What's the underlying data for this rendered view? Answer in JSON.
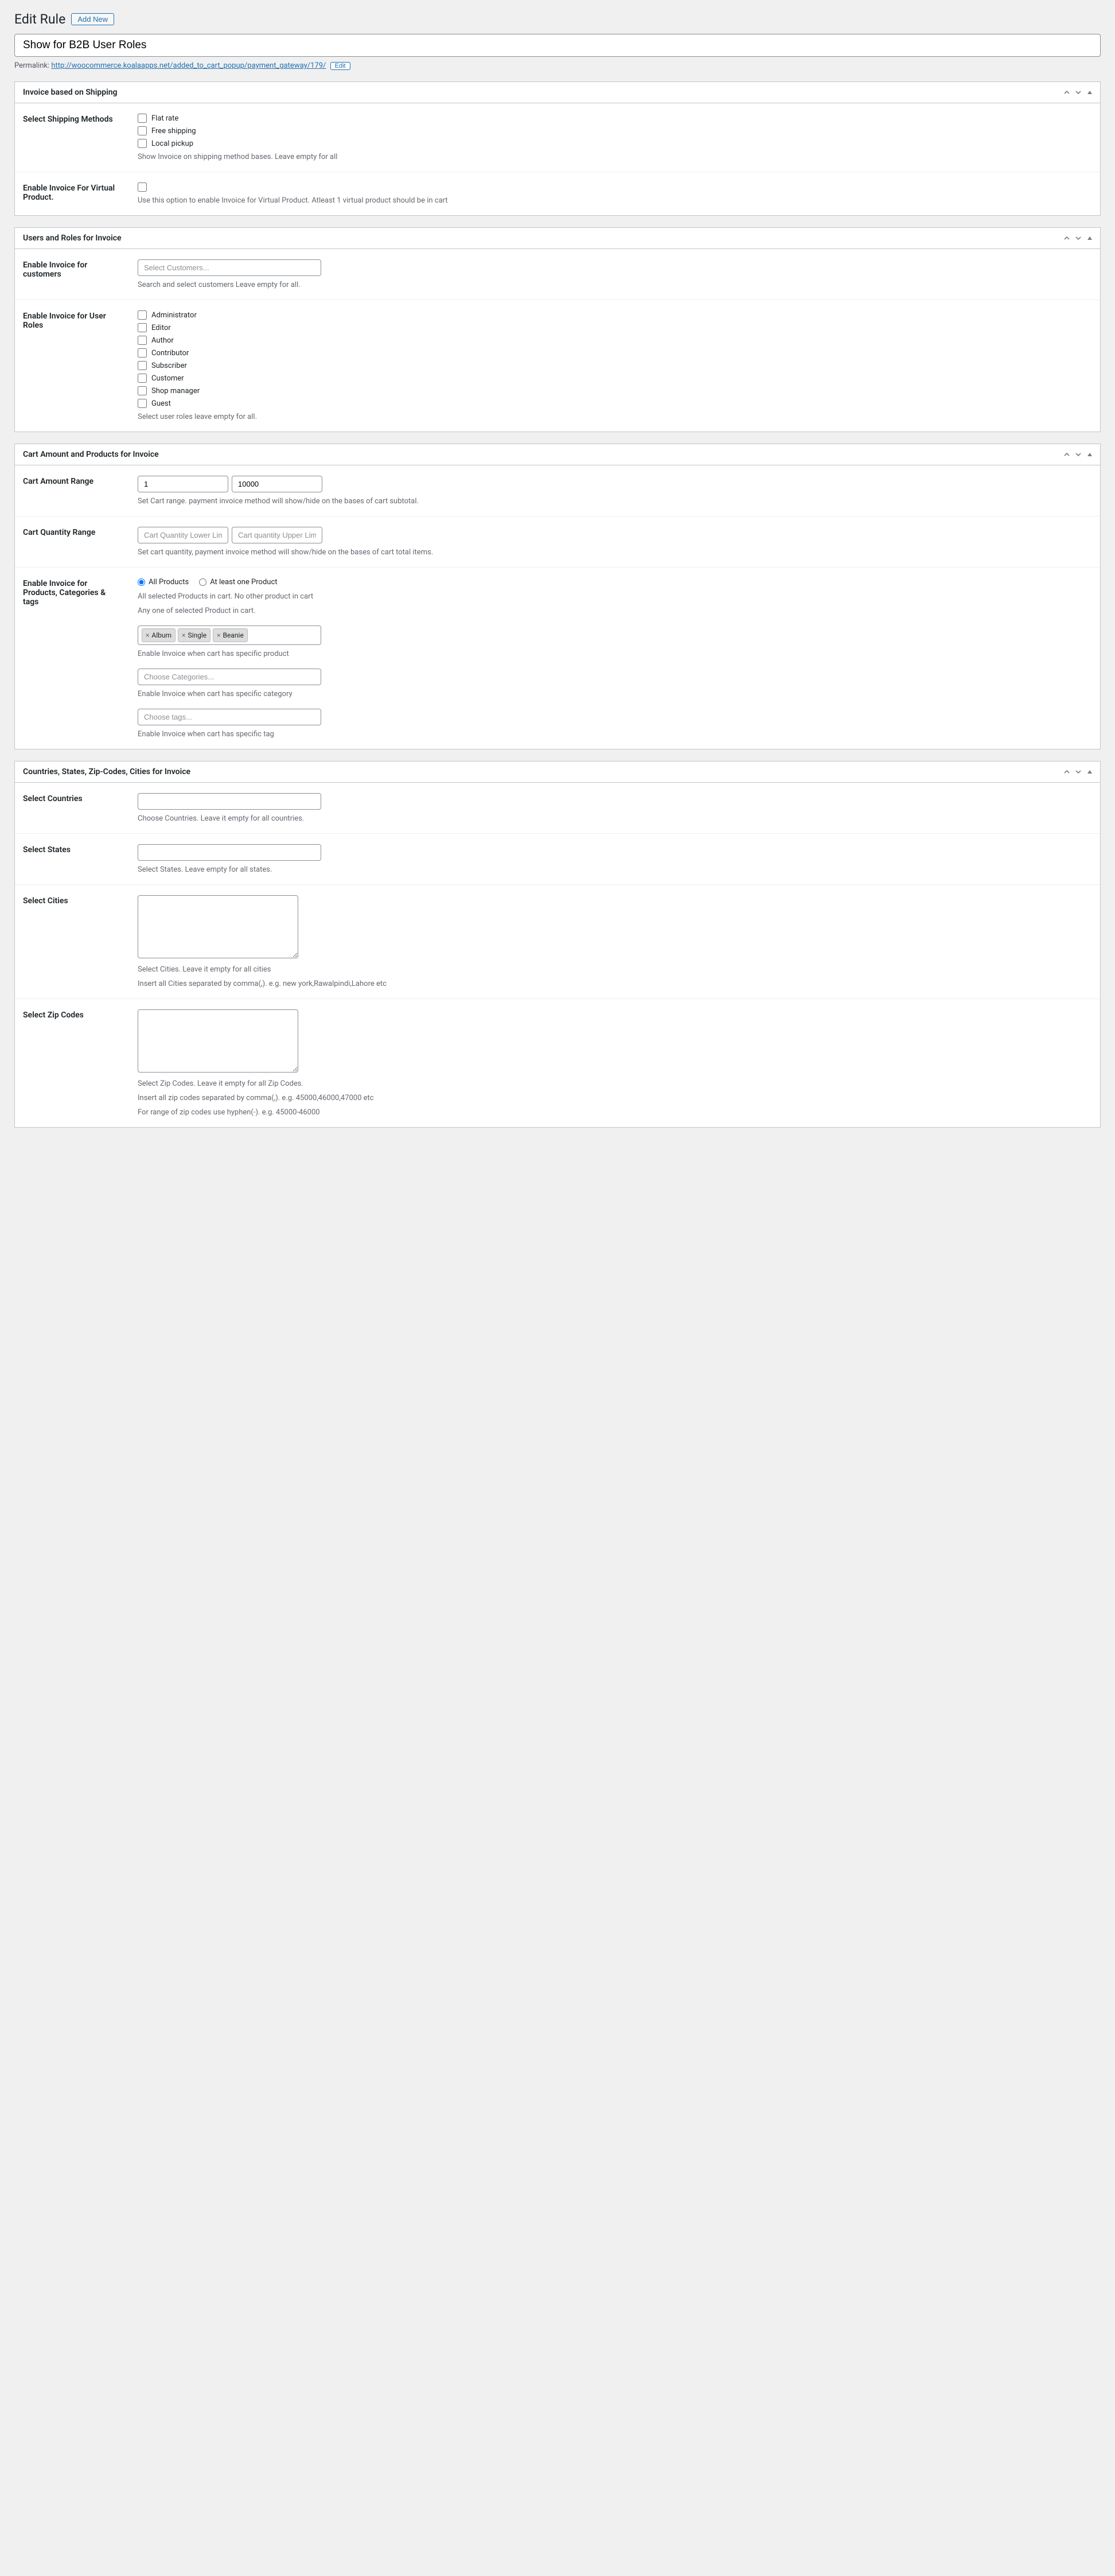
{
  "header": {
    "page_title": "Edit Rule",
    "add_new": "Add New"
  },
  "title_value": "Show for B2B User Roles",
  "permalink": {
    "label": "Permalink: ",
    "url": "http://woocommerce.koalaapps.net/added_to_cart_popup/payment_gateway/",
    "id": "179",
    "slash": "/",
    "edit": "Edit"
  },
  "box1": {
    "title": "Invoice based on Shipping",
    "shipping": {
      "label": "Select Shipping Methods",
      "opt1": "Flat rate",
      "opt2": "Free shipping",
      "opt3": "Local pickup",
      "desc": "Show Invoice on shipping method bases. Leave empty for all"
    },
    "virtual": {
      "label": "Enable Invoice For Virtual Product.",
      "desc": "Use this option to enable Invoice for Virtual Product. Atleast 1 virtual product should be in cart"
    }
  },
  "box2": {
    "title": "Users and Roles for Invoice",
    "customers": {
      "label": "Enable Invoice for customers",
      "placeholder": "Select Customers...",
      "desc": "Search and select customers Leave empty for all."
    },
    "roles": {
      "label": "Enable Invoice for User Roles",
      "r1": "Administrator",
      "r2": "Editor",
      "r3": "Author",
      "r4": "Contributor",
      "r5": "Subscriber",
      "r6": "Customer",
      "r7": "Shop manager",
      "r8": "Guest",
      "desc": "Select user roles leave empty for all."
    }
  },
  "box3": {
    "title": "Cart Amount and Products for Invoice",
    "amount": {
      "label": "Cart Amount Range",
      "low": "1",
      "high": "10000",
      "desc": "Set Cart range. payment invoice method will show/hide on the bases of cart subtotal."
    },
    "qty": {
      "label": "Cart Quantity Range",
      "low_ph": "Cart Quantity Lower Limit",
      "high_ph": "Cart quantity Upper Limit",
      "desc": "Set cart quantity, payment invoice method will show/hide on the bases of cart total items."
    },
    "products": {
      "label": "Enable Invoice for Products, Categories & tags",
      "radio1": "All Products",
      "radio2": "At least one Product",
      "desc_r1": "All selected Products in cart. No other product in cart",
      "desc_r2": "Any one of selected Product in cart.",
      "tag1": "Album",
      "tag2": "Single",
      "tag3": "Beanie",
      "prod_desc": "Enable Invoice when cart has specific product",
      "cat_ph": "Choose Categories...",
      "cat_desc": "Enable Invoice when cart has specific category",
      "tags_ph": "Choose tags...",
      "tags_desc": "Enable Invoice when cart has specific tag"
    }
  },
  "box4": {
    "title": "Countries, States, Zip-Codes, Cities for Invoice",
    "countries": {
      "label": "Select Countries",
      "desc": "Choose Countries. Leave it empty for all countries."
    },
    "states": {
      "label": "Select States",
      "desc": "Select States. Leave empty for all states."
    },
    "cities": {
      "label": "Select Cities",
      "desc1": "Select Cities. Leave it empty for all cities",
      "desc2": "Insert all Cities separated by comma(,). e.g. new york,Rawalpindi,Lahore etc"
    },
    "zips": {
      "label": "Select Zip Codes",
      "desc1": "Select Zip Codes. Leave it empty for all Zip Codes.",
      "desc2": "Insert all zip codes separated by comma(,). e.g. 45000,46000,47000 etc",
      "desc3": "For range of zip codes use hyphen(-). e.g. 45000-46000"
    }
  }
}
